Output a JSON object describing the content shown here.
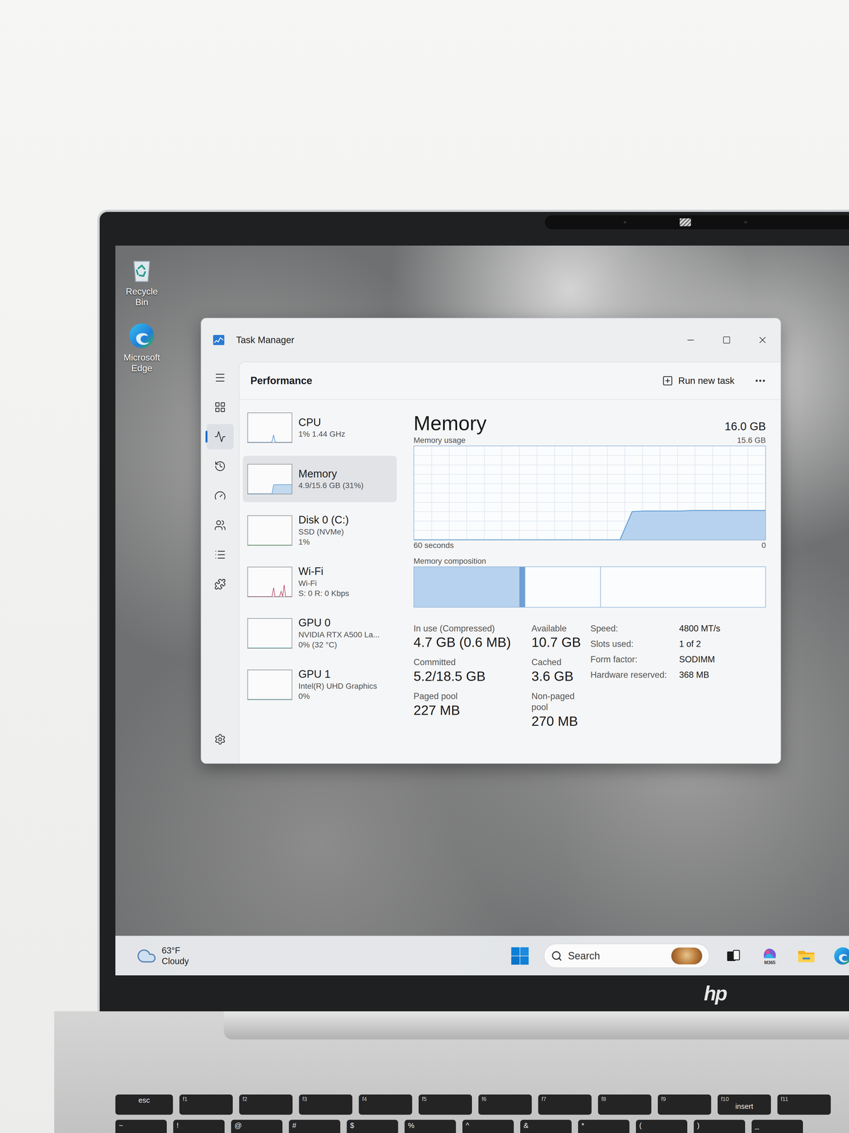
{
  "desktop_icons": [
    {
      "label": "Recycle Bin",
      "kind": "recycle-bin"
    },
    {
      "label": "Microsoft Edge",
      "kind": "edge"
    }
  ],
  "window": {
    "title": "Task Manager"
  },
  "nav": [
    {
      "selected": false
    },
    {
      "selected": false
    },
    {
      "selected": true
    },
    {
      "selected": false
    },
    {
      "selected": false
    },
    {
      "selected": false
    },
    {
      "selected": false
    },
    {
      "selected": false
    }
  ],
  "header": {
    "title": "Performance",
    "action": "Run new task"
  },
  "sidebar": {
    "items": [
      {
        "name": "CPU",
        "details": [
          "1% 1.44 GHz"
        ],
        "selected": false,
        "kind": "line",
        "color": "#4a8fd0",
        "graph": [
          0,
          0,
          0,
          0,
          0,
          0,
          0,
          0,
          0,
          0,
          0,
          0,
          0,
          0,
          0,
          0,
          2,
          25,
          2,
          0,
          0,
          0,
          0,
          0,
          0,
          0,
          0,
          0,
          0,
          0
        ]
      },
      {
        "name": "Memory",
        "details": [
          "4.9/15.6 GB (31%)"
        ],
        "selected": true,
        "kind": "area",
        "color": "#5b9bd5",
        "graph": [
          0,
          0,
          0,
          0,
          0,
          0,
          0,
          0,
          0,
          0,
          0,
          0,
          0,
          0,
          0,
          0,
          0,
          30,
          31,
          31,
          31,
          31,
          31,
          31,
          31,
          31,
          31,
          31,
          31,
          31
        ]
      },
      {
        "name": "Disk 0 (C:)",
        "details": [
          "SSD (NVMe)",
          "1%"
        ],
        "selected": false,
        "kind": "line",
        "color": "#4da34d",
        "graph": [
          0,
          0,
          0,
          0,
          0,
          0,
          0,
          0,
          0,
          0,
          0,
          0,
          0,
          0,
          0,
          0,
          0,
          0,
          0,
          0,
          0,
          0,
          0,
          0,
          0,
          0,
          0,
          0,
          0,
          0
        ]
      },
      {
        "name": "Wi-Fi",
        "details": [
          "Wi-Fi",
          "S: 0 R: 0 Kbps"
        ],
        "selected": false,
        "kind": "line",
        "color": "#b5445e",
        "graph": [
          0,
          0,
          0,
          0,
          0,
          0,
          0,
          0,
          0,
          0,
          0,
          0,
          0,
          0,
          0,
          0,
          0,
          30,
          0,
          0,
          0,
          0,
          18,
          0,
          40,
          0,
          0,
          0,
          0,
          0
        ]
      },
      {
        "name": "GPU 0",
        "details": [
          "NVIDIA RTX A500 La...",
          "0% (32 °C)"
        ],
        "selected": false,
        "kind": "line",
        "color": "#3a9c9c",
        "graph": [
          0,
          0,
          0,
          0,
          0,
          0,
          0,
          0,
          0,
          0,
          0,
          0,
          0,
          0,
          0,
          0,
          0,
          0,
          0,
          0,
          0,
          0,
          0,
          0,
          0,
          0,
          0,
          0,
          0,
          0
        ]
      },
      {
        "name": "GPU 1",
        "details": [
          "Intel(R) UHD Graphics",
          "0%"
        ],
        "selected": false,
        "kind": "line",
        "color": "#3a9c9c",
        "graph": [
          0,
          0,
          0,
          0,
          0,
          0,
          0,
          0,
          0,
          0,
          0,
          0,
          0,
          0,
          0,
          0,
          0,
          0,
          0,
          0,
          0,
          0,
          0,
          0,
          0,
          0,
          0,
          0,
          0,
          0
        ]
      }
    ]
  },
  "memory": {
    "title": "Memory",
    "total": "16.0 GB",
    "usage_label": "Memory usage",
    "usage_max": "15.6 GB",
    "axis_max": 15.6,
    "x_start": "60 seconds",
    "x_end": "0",
    "values": [
      0,
      0,
      0,
      0,
      0,
      0,
      0,
      0,
      0,
      0,
      0,
      0,
      0,
      0,
      0,
      0,
      0,
      0,
      4.7,
      4.8,
      4.8,
      4.8,
      4.8,
      4.9,
      4.9,
      4.9,
      4.9,
      4.9,
      4.9,
      4.9
    ],
    "composition_label": "Memory composition",
    "composition": [
      {
        "kind": "in-use",
        "level": 0.3
      },
      {
        "kind": "modified",
        "level": 0.015
      },
      {
        "kind": "standby",
        "level": 0.215
      },
      {
        "kind": "free",
        "level": 0.47
      }
    ],
    "stats": [
      {
        "label": "In use (Compressed)",
        "value": "4.7 GB (0.6 MB)"
      },
      {
        "label": "Available",
        "value": "10.7 GB"
      },
      {
        "label": "Committed",
        "value": "5.2/18.5 GB"
      },
      {
        "label": "Cached",
        "value": "3.6 GB"
      },
      {
        "label": "Paged pool",
        "value": "227 MB"
      },
      {
        "label": "Non-paged pool",
        "value": "270 MB"
      }
    ],
    "specs": [
      {
        "label": "Speed:",
        "value": "4800 MT/s"
      },
      {
        "label": "Slots used:",
        "value": "1 of 2"
      },
      {
        "label": "Form factor:",
        "value": "SODIMM"
      },
      {
        "label": "Hardware reserved:",
        "value": "368 MB"
      }
    ]
  },
  "taskbar": {
    "weather": {
      "temperature": "63°F",
      "condition": "Cloudy"
    },
    "search": {
      "placeholder": "Search"
    },
    "apps": [
      {
        "kind": "task-view"
      },
      {
        "kind": "m365",
        "badge": "M365"
      },
      {
        "kind": "explorer"
      },
      {
        "kind": "edge"
      }
    ]
  },
  "bezel": {
    "logo": "hp"
  },
  "keyboard": {
    "rows": [
      [
        {
          "label": "esc"
        },
        {
          "fn": "f1"
        },
        {
          "fn": "f2"
        },
        {
          "fn": "f3"
        },
        {
          "fn": "f4"
        },
        {
          "fn": "f5"
        },
        {
          "fn": "f6"
        },
        {
          "fn": "f7"
        },
        {
          "fn": "f8"
        },
        {
          "fn": "f9"
        },
        {
          "fn": "f10",
          "label": "insert"
        },
        {
          "fn": "f11"
        }
      ],
      [
        {
          "label": "~"
        },
        {
          "label": "!"
        },
        {
          "label": "@"
        },
        {
          "label": "#"
        },
        {
          "label": "$"
        },
        {
          "label": "%"
        },
        {
          "label": "^"
        },
        {
          "label": "&"
        },
        {
          "label": "*"
        },
        {
          "label": "("
        },
        {
          "label": ")"
        },
        {
          "label": "_"
        }
      ]
    ]
  }
}
